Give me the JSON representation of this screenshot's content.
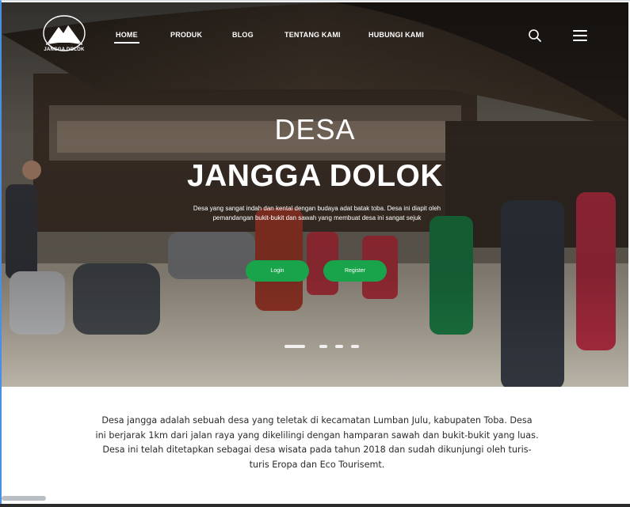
{
  "brand": {
    "logo_text": "JANGGA DOLOK"
  },
  "nav": {
    "items": [
      {
        "label": "HOME",
        "active": true
      },
      {
        "label": "PRODUK",
        "active": false
      },
      {
        "label": "BLOG",
        "active": false
      },
      {
        "label": "TENTANG KAMI",
        "active": false
      },
      {
        "label": "HUBUNGI KAMI",
        "active": false
      }
    ],
    "search_icon": "search-icon",
    "menu_icon": "hamburger-menu-icon"
  },
  "hero": {
    "title_line1": "DESA",
    "title_line2": "JANGGA DOLOK",
    "description": "Desa yang sangat indah dan kental dengan budaya adat batak toba. Desa ini diapit oleh pemandangan bukit-bukit dan sawah yang membuat desa ini sangat sejuk",
    "login_label": "Login",
    "register_label": "Register",
    "button_color": "#19a34a",
    "carousel": {
      "slides": 4,
      "active_index": 0
    }
  },
  "about": {
    "text": "Desa jangga adalah sebuah desa yang teletak di kecamatan Lumban Julu, kabupaten Toba. Desa ini berjarak 1km dari jalan raya  yang dikelilingi dengan hamparan  sawah dan bukit-bukit yang luas. Desa ini telah ditetapkan sebagai desa wisata pada tahun 2018 dan sudah dikunjungi oleh turis-turis Eropa dan Eco Tourisemt."
  }
}
